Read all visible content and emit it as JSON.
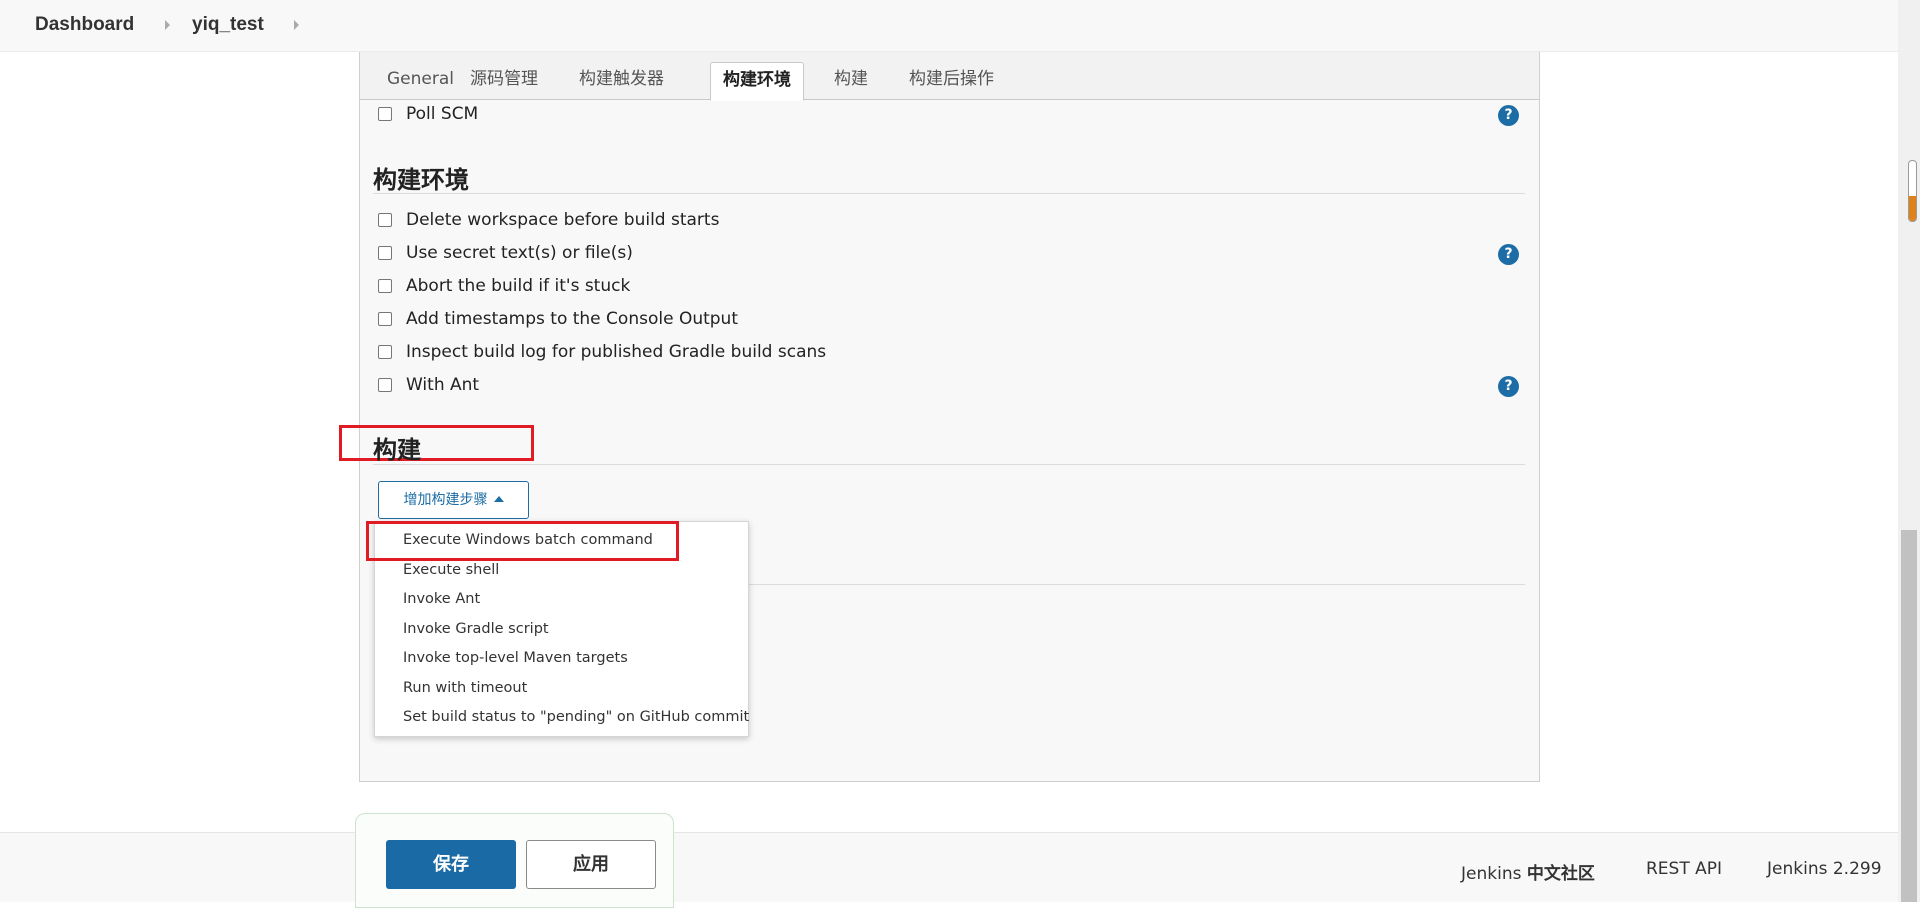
{
  "breadcrumb": {
    "items": [
      "Dashboard",
      "yiq_test"
    ]
  },
  "tabs": [
    "General",
    "源码管理",
    "构建触发器",
    "构建环境",
    "构建",
    "构建后操作"
  ],
  "active_tab": "构建环境",
  "scm_section": {
    "poll_scm_label": "Poll SCM"
  },
  "build_env": {
    "title": "构建环境",
    "options": [
      "Delete workspace before build starts",
      "Use secret text(s) or file(s)",
      "Abort the build if it's stuck",
      "Add timestamps to the Console Output",
      "Inspect build log for published Gradle build scans",
      "With Ant"
    ]
  },
  "build": {
    "title": "构建",
    "add_step_label": "增加构建步骤",
    "menu_items": [
      "Execute Windows batch command",
      "Execute shell",
      "Invoke Ant",
      "Invoke Gradle script",
      "Invoke top-level Maven targets",
      "Run with timeout",
      "Set build status to \"pending\" on GitHub commit"
    ]
  },
  "actions": {
    "save_label": "保存",
    "apply_label": "应用"
  },
  "footer": {
    "community_prefix": "Jenkins",
    "community_bold": "中文社区",
    "rest_api": "REST API",
    "version": "Jenkins 2.299"
  },
  "help_icon_text": "?",
  "icons": {
    "help": "help-icon",
    "crumb_separator": "chevron-right-icon",
    "dropdown_caret": "caret-up-icon"
  },
  "colors": {
    "accent": "#1c6ca5",
    "highlight_box": "#e01b24",
    "scroll_marker": "#e0821c"
  }
}
